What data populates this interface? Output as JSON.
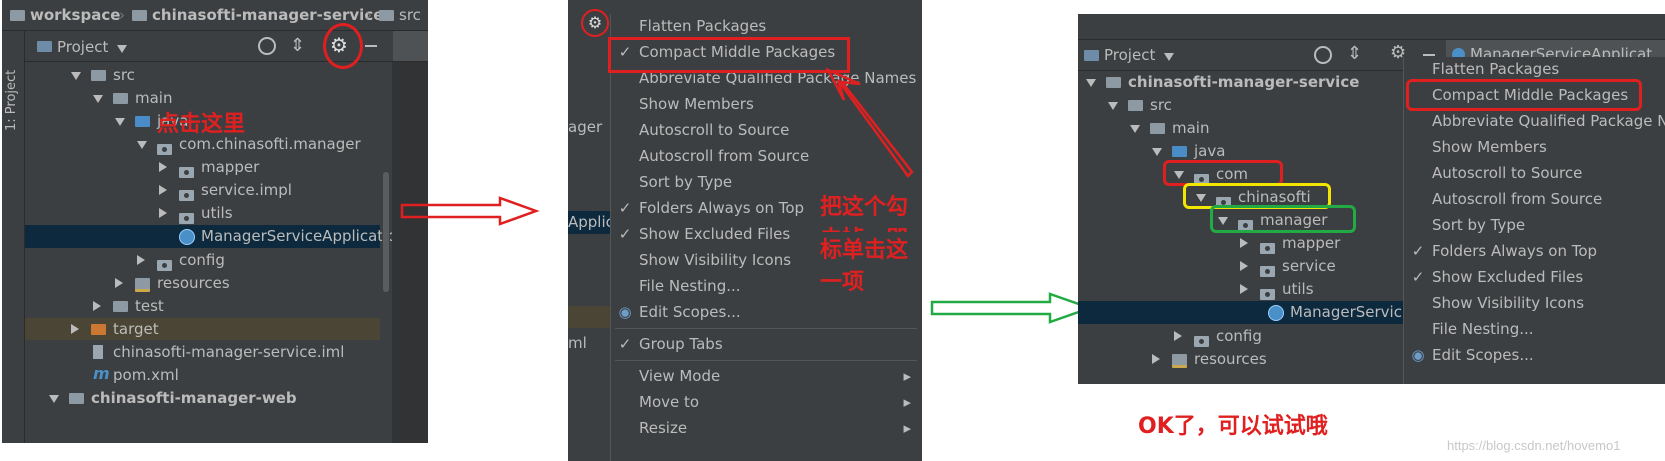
{
  "left": {
    "breadcrumb": [
      "workspace",
      "chinasofti-manager-service",
      "src"
    ],
    "sidebar_tab": "1: Project",
    "toolbar_title": "Project",
    "annotation": "点击这里",
    "tree": [
      {
        "label": "src"
      },
      {
        "label": "main"
      },
      {
        "label": "java"
      },
      {
        "label": "com.chinasofti.manager"
      },
      {
        "label": "mapper"
      },
      {
        "label": "service.impl"
      },
      {
        "label": "utils"
      },
      {
        "label": "ManagerServiceApplication"
      },
      {
        "label": "config"
      },
      {
        "label": "resources"
      },
      {
        "label": "test"
      },
      {
        "label": "target"
      },
      {
        "label": "chinasofti-manager-service.iml"
      },
      {
        "label": "pom.xml"
      },
      {
        "label": "chinasofti-manager-web"
      }
    ]
  },
  "middle": {
    "menu": [
      {
        "label": "Flatten Packages",
        "checked": ""
      },
      {
        "label": "Compact Middle Packages",
        "checked": "✓"
      },
      {
        "label": "Abbreviate Qualified Package Names",
        "checked": ""
      },
      {
        "label": "Show Members",
        "checked": ""
      },
      {
        "label": "Autoscroll to Source",
        "checked": ""
      },
      {
        "label": "Autoscroll from Source",
        "checked": ""
      },
      {
        "label": "Sort by Type",
        "checked": ""
      },
      {
        "label": "Folders Always on Top",
        "checked": "✓"
      },
      {
        "label": "Show Excluded Files",
        "checked": "✓"
      },
      {
        "label": "Show Visibility Icons",
        "checked": ""
      },
      {
        "label": "File Nesting...",
        "checked": ""
      },
      {
        "label": "Edit Scopes...",
        "checked": ""
      },
      {
        "label": "Group Tabs",
        "checked": "✓"
      },
      {
        "label": "View Mode",
        "checked": ""
      },
      {
        "label": "Move to",
        "checked": ""
      },
      {
        "label": "Resize",
        "checked": ""
      }
    ],
    "behind_text": [
      "ager",
      "Applic",
      "ml"
    ],
    "annotation_line1": "把这个勾去掉，即鼠",
    "annotation_line2": "标单击这一项"
  },
  "right": {
    "toolbar_title": "Project",
    "tab_label": "ManagerServiceApplicat",
    "tree": [
      {
        "label": "chinasofti-manager-service"
      },
      {
        "label": "src"
      },
      {
        "label": "main"
      },
      {
        "label": "java"
      },
      {
        "label": "com"
      },
      {
        "label": "chinasofti"
      },
      {
        "label": "manager"
      },
      {
        "label": "mapper"
      },
      {
        "label": "service"
      },
      {
        "label": "utils"
      },
      {
        "label": "ManagerServic"
      },
      {
        "label": "config"
      },
      {
        "label": "resources"
      }
    ],
    "menu": [
      {
        "label": "Flatten Packages",
        "checked": ""
      },
      {
        "label": "Compact Middle Packages",
        "checked": ""
      },
      {
        "label": "Abbreviate Qualified Package Na",
        "checked": ""
      },
      {
        "label": "Show Members",
        "checked": ""
      },
      {
        "label": "Autoscroll to Source",
        "checked": ""
      },
      {
        "label": "Autoscroll from Source",
        "checked": ""
      },
      {
        "label": "Sort by Type",
        "checked": ""
      },
      {
        "label": "Folders Always on Top",
        "checked": "✓"
      },
      {
        "label": "Show Excluded Files",
        "checked": "✓"
      },
      {
        "label": "Show Visibility Icons",
        "checked": ""
      },
      {
        "label": "File Nesting...",
        "checked": ""
      },
      {
        "label": "Edit Scopes...",
        "checked": ""
      }
    ],
    "annotation": "OK了，可以试试哦",
    "watermark": "https://blog.csdn.net/hovemo1"
  },
  "colors": {
    "panel": "#3c3f41",
    "text": "#bbbbbb",
    "red": "#e02020",
    "green": "#22aa44",
    "yellow": "#f2e600"
  }
}
